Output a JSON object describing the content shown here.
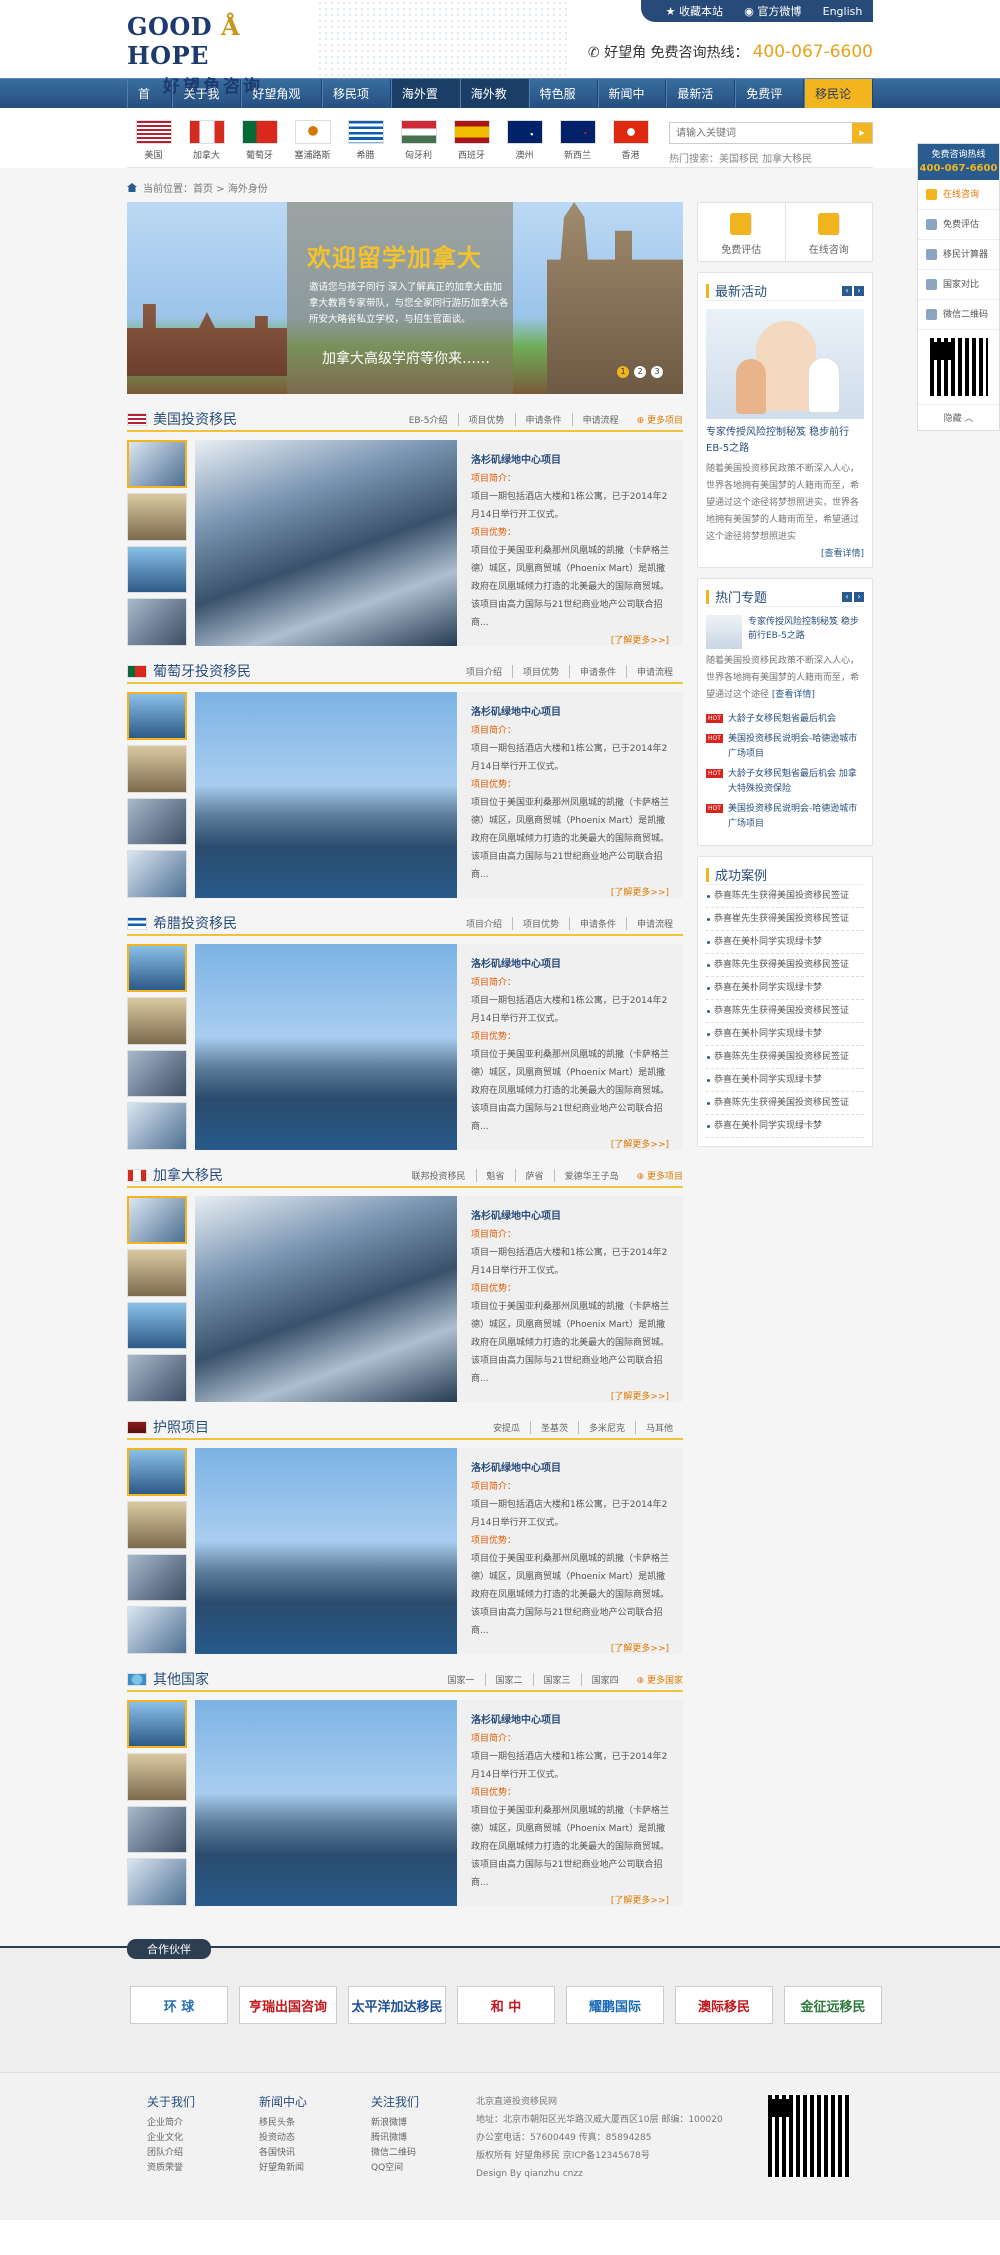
{
  "header": {
    "logo_en_1": "GOOD",
    "logo_en_2": "HOPE",
    "logo_zh": "好望角咨询",
    "top_links": [
      "收藏本站",
      "官方微博",
      "English"
    ],
    "hotline_label": "好望角 免费咨询热线：",
    "hotline_number": "400-067-6600"
  },
  "nav": {
    "items": [
      "首页",
      "关于我们",
      "好望角观点",
      "移民项目",
      "海外置业",
      "海外教育",
      "特色服务",
      "新闻中心",
      "最新活动",
      "免费评估",
      "移民论坛"
    ]
  },
  "flags": {
    "countries": [
      "美国",
      "加拿大",
      "葡萄牙",
      "塞浦路斯",
      "希腊",
      "匈牙利",
      "西班牙",
      "澳州",
      "新西兰",
      "香港"
    ],
    "search_placeholder": "请输入关键词",
    "hot_search": "热门搜索：美国移民   加拿大移民"
  },
  "breadcrumb": "当前位置：首页 > 海外身份",
  "banner": {
    "title": "欢迎留学加拿大",
    "text": "邀请您与孩子同行 深入了解真正的加拿大由加拿大教育专家带队，与您全家同行游历加拿大各所安大略省私立学校，与招生官面谈。",
    "subtitle": "加拿大高级学府等你来……",
    "dots": [
      "1",
      "2",
      "3"
    ]
  },
  "sections": [
    {
      "title": "美国投资移民",
      "links": [
        "EB-5介绍",
        "项目优势",
        "申请条件",
        "申请流程"
      ],
      "more": "更多项目"
    },
    {
      "title": "葡萄牙投资移民",
      "links": [
        "项目介绍",
        "项目优势",
        "申请条件",
        "申请流程"
      ],
      "more": ""
    },
    {
      "title": "希腊投资移民",
      "links": [
        "项目介绍",
        "项目优势",
        "申请条件",
        "申请流程"
      ],
      "more": ""
    },
    {
      "title": "加拿大移民",
      "links": [
        "联邦投资移民",
        "魁省",
        "萨省",
        "爱德华王子岛"
      ],
      "more": "更多项目"
    },
    {
      "title": "护照项目",
      "links": [
        "安提瓜",
        "圣基茨",
        "多米尼克",
        "马耳他"
      ],
      "more": ""
    },
    {
      "title": "其他国家",
      "links": [
        "国家一",
        "国家二",
        "国家三",
        "国家四"
      ],
      "more": "更多国家"
    }
  ],
  "project_card": {
    "title": "洛杉矶绿地中心项目",
    "intro_label": "项目简介：",
    "intro": "项目一期包括酒店大楼和1栋公寓，已于2014年2月14日举行开工仪式。",
    "adv_label": "项目优势：",
    "adv": "项目位于美国亚利桑那州凤凰城的凯撒（卡萨格兰德）城区，凤凰商贸城（Phoenix Mart）是凯撒政府在凤凰城倾力打造的北美最大的国际商贸城。该项目由高力国际与21世纪商业地产公司联合招商...",
    "more": "[了解更多>>]"
  },
  "sidebar": {
    "eval": "免费评估",
    "consult": "在线咨询",
    "activity_title": "最新活动",
    "activity_caption": "专家传授风险控制秘笈 稳步前行EB-5之路",
    "activity_text": "随着美国投资移民政策不断深入人心，世界各地拥有美国梦的人籍雨而至，希望通过这个途径将梦想照进实，世界各地拥有美国梦的人籍雨而至，希望通过这个途径将梦想照进实",
    "detail": "[查看详情]",
    "hot_title": "热门专题",
    "hot_caption": "专家传授风险控制秘笈 稳步前行EB-5之路",
    "hot_text": "随着美国投资移民政策不断深入人心，世界各地拥有美国梦的人籍雨而至，希望通过这个途径",
    "hot_list": [
      "大龄子女移民魁省最后机会",
      "美国投资移民说明会-哈德逊城市广场项目",
      "大龄子女移民魁省最后机会 加拿大特殊投资保险",
      "美国投资移民说明会-哈德逊城市广场项目"
    ],
    "hot_badge": "HOT",
    "case_title": "成功案例",
    "cases": [
      "恭喜陈先生获得美国投资移民签证",
      "恭喜崔先生获得美国投资移民签证",
      "恭喜在美朴同学实现绿卡梦",
      "恭喜陈先生获得美国投资移民签证",
      "恭喜在美朴同学实现绿卡梦",
      "恭喜陈先生获得美国投资移民签证",
      "恭喜在美朴同学实现绿卡梦",
      "恭喜陈先生获得美国投资移民签证",
      "恭喜在美朴同学实现绿卡梦",
      "恭喜陈先生获得美国投资移民签证",
      "恭喜在美朴同学实现绿卡梦"
    ]
  },
  "float_widget": {
    "head": "免费咨询热线",
    "number": "400-067-6600",
    "items": [
      "在线咨询",
      "免费评估",
      "移民计算器",
      "国家对比",
      "微信二维码"
    ],
    "hide": "隐藏 ︿"
  },
  "partners": {
    "title": "合作伙伴",
    "logos": [
      "环 球",
      "亨瑞出国咨询",
      "太平洋加达移民",
      "和 中",
      "耀鹏国际",
      "澳际移民",
      "金征远移民"
    ]
  },
  "footer": {
    "cols": [
      {
        "title": "关于我们",
        "items": [
          "企业简介",
          "企业文化",
          "团队介绍",
          "资质荣誉"
        ]
      },
      {
        "title": "新闻中心",
        "items": [
          "移民头条",
          "投资动态",
          "各国快讯",
          "好望角新闻"
        ]
      },
      {
        "title": "关注我们",
        "items": [
          "新浪微博",
          "腾讯微博",
          "微信二维码",
          "QQ空间"
        ]
      }
    ],
    "info": [
      "北京直道投资移民网",
      "地址：北京市朝阳区光华路汉威大厦西区10层 邮编：100020",
      "办公室电话：57600449 传真：85894285",
      "版权所有 好望角移民  京ICP备12345678号",
      "Design By qianzhu  cnzz"
    ]
  },
  "colors": {
    "nav_blue": "#2a5b8e",
    "accent": "#f2b51f",
    "orange": "#e07a00"
  }
}
